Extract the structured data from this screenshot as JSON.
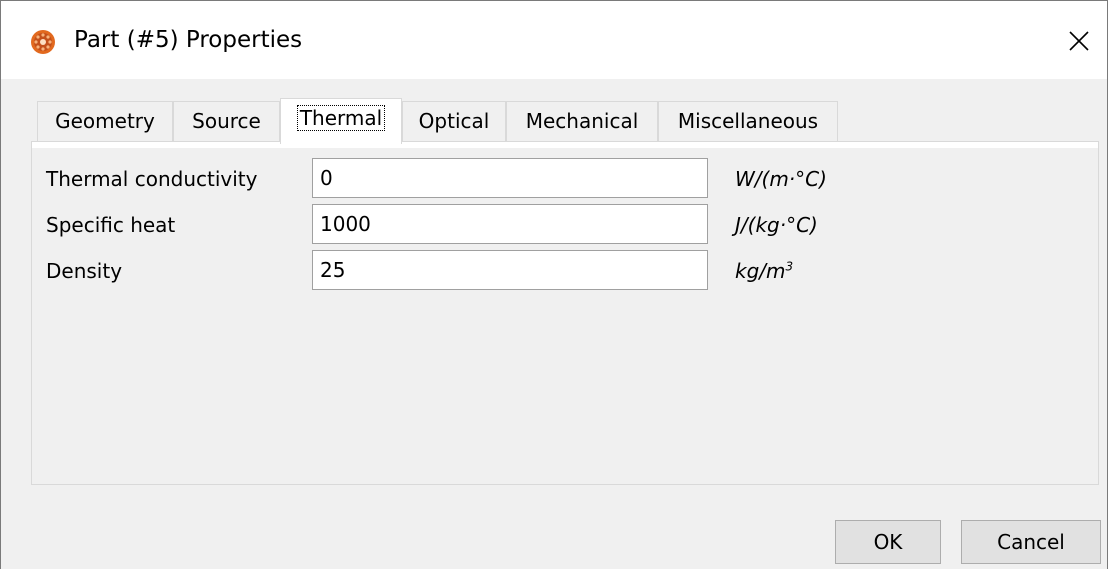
{
  "window": {
    "title": "Part (#5) Properties",
    "icon": "orange-gear-icon",
    "close_icon": "close-icon"
  },
  "tabs": [
    {
      "label": "Geometry",
      "active": false
    },
    {
      "label": "Source",
      "active": false
    },
    {
      "label": "Thermal",
      "active": true
    },
    {
      "label": "Optical",
      "active": false
    },
    {
      "label": "Mechanical",
      "active": false
    },
    {
      "label": "Miscellaneous",
      "active": false
    }
  ],
  "fields": [
    {
      "label": "Thermal conductivity",
      "value": "0",
      "unit": "W/(m·°C)"
    },
    {
      "label": "Specific heat",
      "value": "1000",
      "unit": "J/(kg·°C)"
    },
    {
      "label": "Density",
      "value": "25",
      "unit": "kg/m",
      "unit_sup": "3"
    }
  ],
  "buttons": {
    "ok_label": "OK",
    "cancel_label": "Cancel"
  },
  "colors": {
    "dialog_bg": "#f0f0f0",
    "icon_orange": "#e2691e",
    "border": "#d9d9d9"
  }
}
